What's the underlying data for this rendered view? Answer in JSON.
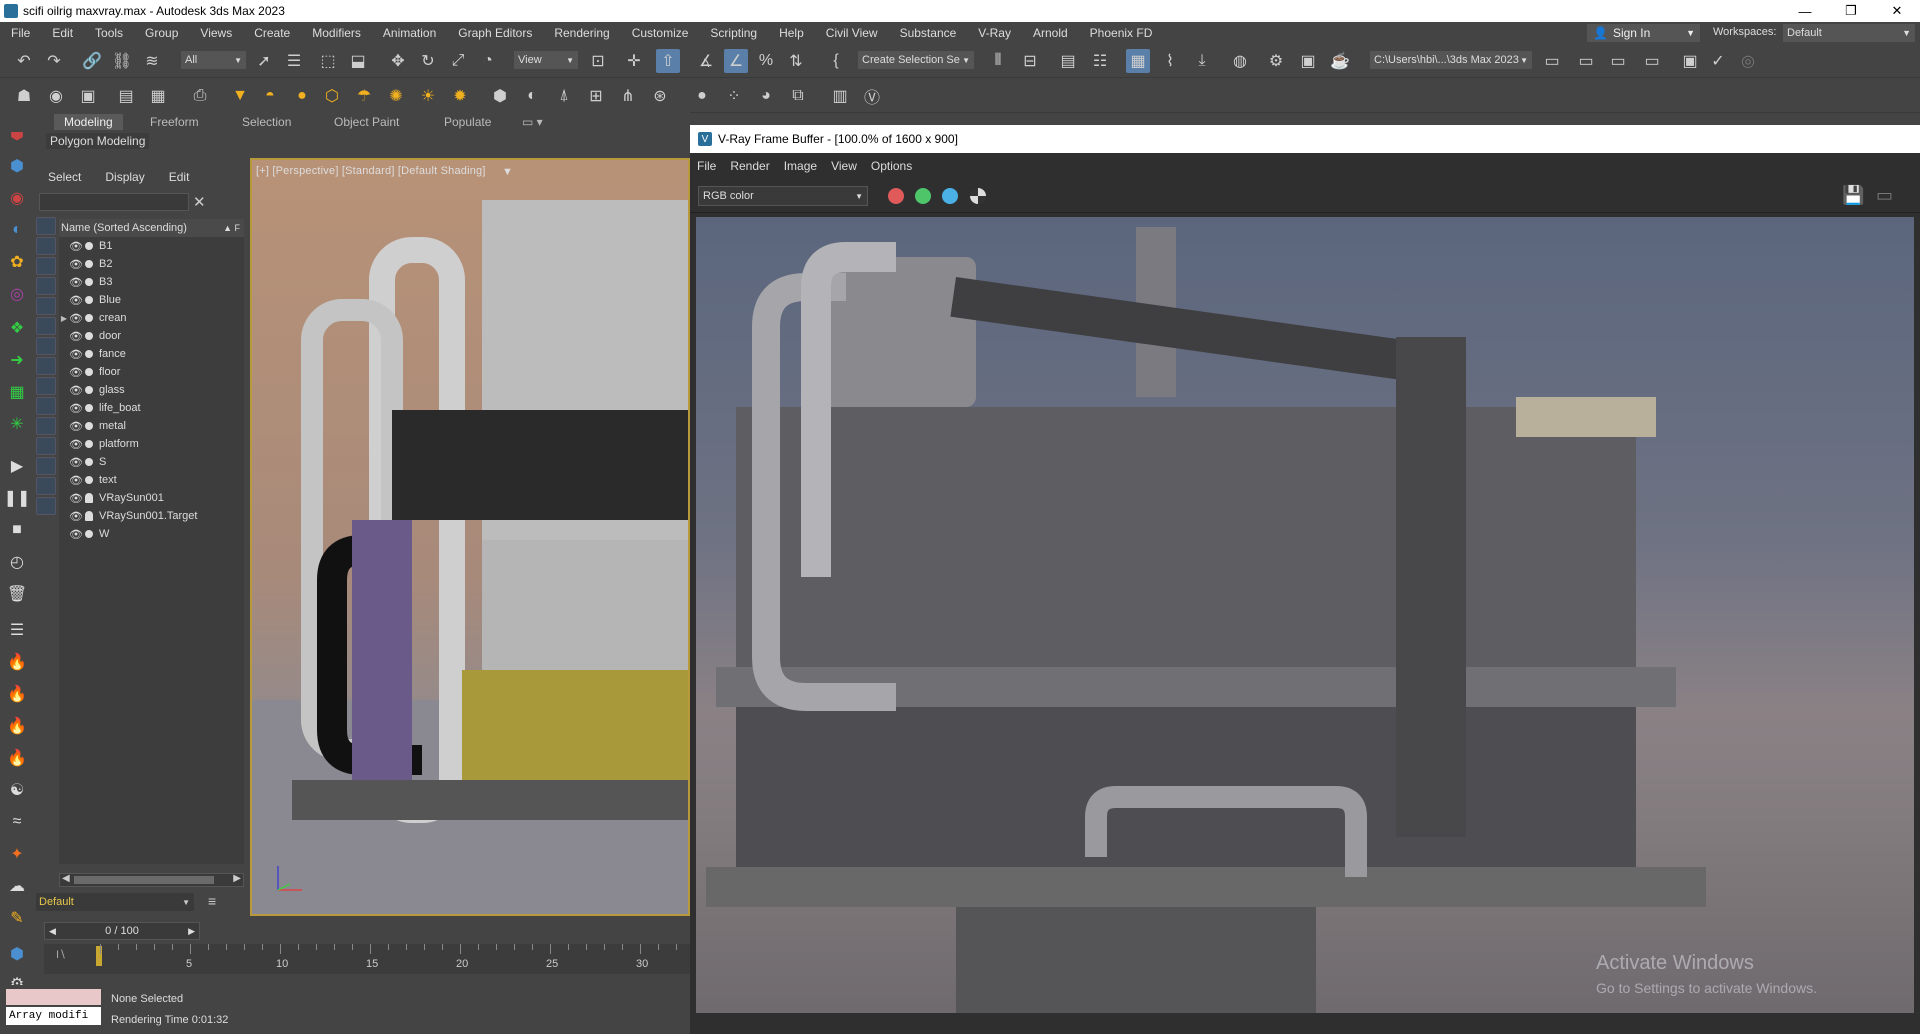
{
  "window": {
    "title": "scifi oilrig maxvray.max - Autodesk 3ds Max 2023",
    "minimize": "—",
    "maximize": "❐",
    "close": "✕"
  },
  "menubar": {
    "items": [
      "File",
      "Edit",
      "Tools",
      "Group",
      "Views",
      "Create",
      "Modifiers",
      "Animation",
      "Graph Editors",
      "Rendering",
      "Customize",
      "Scripting",
      "Help",
      "Civil View",
      "Substance",
      "V-Ray",
      "Arnold",
      "Phoenix FD"
    ],
    "sign_in": "Sign In",
    "workspaces_label": "Workspaces:",
    "workspace_value": "Default"
  },
  "toolbar": {
    "selection_filter": "All",
    "ref_coord": "View",
    "named_selection": "Create Selection Se",
    "project_path": "C:\\Users\\hbi\\...\\3ds Max 2023"
  },
  "ribbon": {
    "tabs": [
      "Modeling",
      "Freeform",
      "Selection",
      "Object Paint",
      "Populate"
    ],
    "active_tab": "Modeling",
    "sub_label": "Polygon Modeling"
  },
  "explorer": {
    "tabs": [
      "Select",
      "Display",
      "Edit"
    ],
    "column_header": "Name (Sorted Ascending)",
    "sort_indicator": "▲ F",
    "items": [
      {
        "name": "B1",
        "type": "object"
      },
      {
        "name": "B2",
        "type": "object"
      },
      {
        "name": "B3",
        "type": "object"
      },
      {
        "name": "Blue",
        "type": "object"
      },
      {
        "name": "crean",
        "type": "group",
        "expandable": true
      },
      {
        "name": "door",
        "type": "object"
      },
      {
        "name": "fance",
        "type": "object"
      },
      {
        "name": "floor",
        "type": "object"
      },
      {
        "name": "glass",
        "type": "object"
      },
      {
        "name": "life_boat",
        "type": "object"
      },
      {
        "name": "metal",
        "type": "object"
      },
      {
        "name": "platform",
        "type": "object"
      },
      {
        "name": "S",
        "type": "object"
      },
      {
        "name": "text",
        "type": "object"
      },
      {
        "name": "VRaySun001",
        "type": "light"
      },
      {
        "name": "VRaySun001.Target",
        "type": "light"
      },
      {
        "name": "W",
        "type": "object"
      }
    ],
    "layer": "Default"
  },
  "viewport": {
    "label": "[+] [Perspective] [Standard] [Default Shading]"
  },
  "timeline": {
    "frame_display": "0 / 100",
    "ticks": [
      "5",
      "10",
      "15",
      "20",
      "25",
      "30"
    ]
  },
  "status": {
    "maxscript_text": "Array modifi",
    "selection": "None Selected",
    "render_time_label": "Rendering Time  0:01:32"
  },
  "vfb": {
    "title": "V-Ray Frame Buffer - [100.0% of 1600 x 900]",
    "menu": [
      "File",
      "Render",
      "Image",
      "View",
      "Options"
    ],
    "channel": "RGB color",
    "channel_colors": [
      "#e05a5a",
      "#4fc56a",
      "#4ab0e6"
    ],
    "watermark_title": "Activate Windows",
    "watermark_sub": "Go to Settings to activate Windows."
  },
  "colors": {
    "ui_bg": "#444444",
    "active_blue": "#5a7fa8",
    "viewport_border": "#b89a3c",
    "layer_text": "#e6c84a"
  }
}
